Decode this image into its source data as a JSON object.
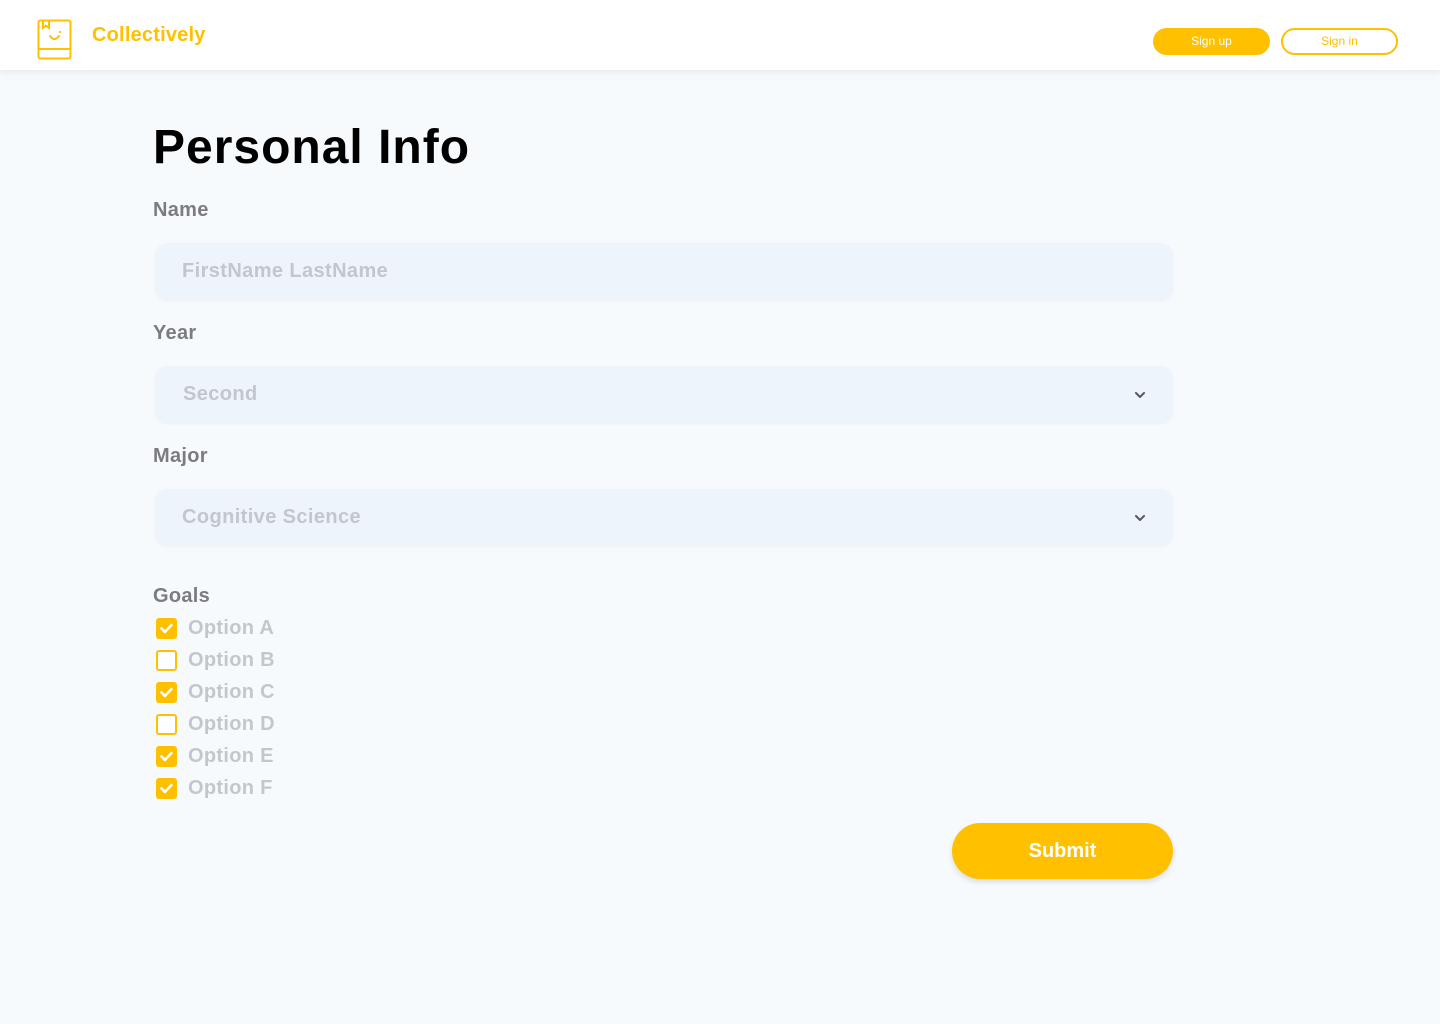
{
  "header": {
    "brand": "Collectively",
    "signup_label": "Sign up",
    "signin_label": "Sign in"
  },
  "page": {
    "title": "Personal Info"
  },
  "form": {
    "name_label": "Name",
    "name_placeholder": "FirstName LastName",
    "year_label": "Year",
    "year_value": "Second",
    "major_label": "Major",
    "major_value": "Cognitive Science",
    "goals_label": "Goals",
    "goals": [
      {
        "label": "Option A",
        "checked": true
      },
      {
        "label": "Option B",
        "checked": false
      },
      {
        "label": "Option C",
        "checked": true
      },
      {
        "label": "Option D",
        "checked": false
      },
      {
        "label": "Option E",
        "checked": true
      },
      {
        "label": "Option F",
        "checked": true
      }
    ],
    "submit_label": "Submit"
  },
  "icons": {
    "logo": "book-smile-icon",
    "dropdown": "chevron-down-icon",
    "check": "check-icon"
  },
  "colors": {
    "accent": "#ffc000",
    "background": "#f7fafd",
    "field": "#eef4fc",
    "label": "#7c7c80",
    "placeholder": "#c3c7cc"
  }
}
